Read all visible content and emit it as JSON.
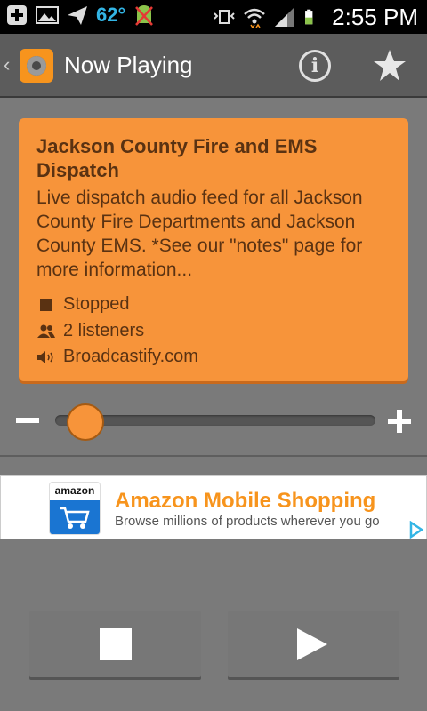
{
  "status_bar": {
    "temperature": "62°",
    "time": "2:55 PM"
  },
  "action_bar": {
    "back_glyph": "‹",
    "title": "Now Playing",
    "info_glyph": "i",
    "icons": [
      "app-logo-icon",
      "info-icon",
      "favorite-star-icon"
    ]
  },
  "feed": {
    "title": "Jackson County Fire and EMS Dispatch",
    "description": "Live dispatch audio feed for all Jackson County Fire Departments and Jackson County EMS. *See our \"notes\" page for more information...",
    "status": "Stopped",
    "listeners": "2 listeners",
    "source": "Broadcastify.com"
  },
  "volume": {
    "level": 0.05
  },
  "ad": {
    "logo_text": "amazon",
    "title": "Amazon Mobile Shopping",
    "subtitle": "Browse millions of products wherever you go"
  },
  "controls": {
    "icons": [
      "stop-icon",
      "play-icon"
    ]
  },
  "colors": {
    "accent": "#f7943a",
    "card_text": "#5a3212",
    "background": "#7a7a7a",
    "holo_blue": "#33b5e5"
  }
}
